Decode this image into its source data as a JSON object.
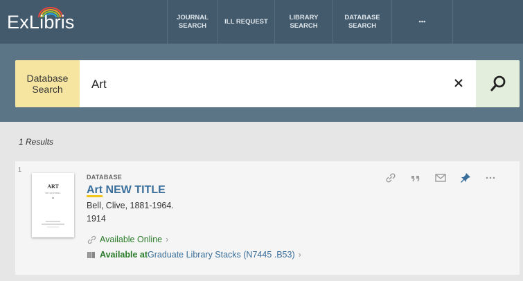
{
  "header": {
    "logo_text": "ExLibris",
    "nav": [
      {
        "label": "JOURNAL\nSEARCH"
      },
      {
        "label": "ILL REQUEST"
      },
      {
        "label": "LIBRARY\nSEARCH"
      },
      {
        "label": "DATABASE\nSEARCH"
      },
      {
        "label": "•••"
      }
    ]
  },
  "search": {
    "scope_label": "Database\nSearch",
    "query": "Art"
  },
  "results": {
    "count_label": "1 Results",
    "items": [
      {
        "index": "1",
        "type": "DATABASE",
        "title_highlight": "Art",
        "title_rest": " NEW TITLE",
        "author": "Bell, Clive, 1881-1964.",
        "year": "1914",
        "online_label": "Available Online",
        "physical_status": "Available at",
        "physical_location": " Graduate Library  Stacks (N7445 .B53)",
        "thumb_title": "ART",
        "thumb_subtitle": "BY CLIVE BELL"
      }
    ]
  },
  "colors": {
    "topbar": "#425a6c",
    "search_band": "#5b7587",
    "scope_bg": "#f6e5a0",
    "go_bg": "#e3efdc",
    "link": "#3a6e9a",
    "available": "#2b7a2b"
  }
}
